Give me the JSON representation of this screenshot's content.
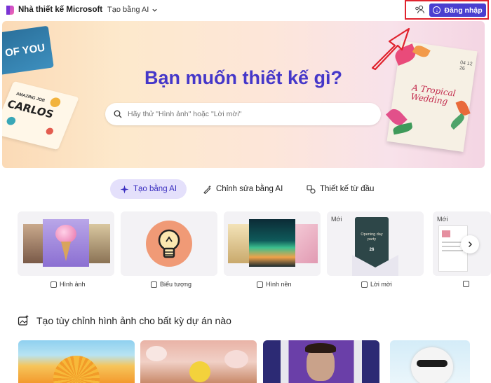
{
  "header": {
    "brand": "Nhà thiết kế Microsoft",
    "create_menu": "Tạo bằng AI",
    "signin_label": "Đăng nhập"
  },
  "hero": {
    "title": "Bạn muốn thiết kế gì?",
    "search_placeholder": "Hãy thử \"Hình ảnh\" hoặc \"Lời mời\"",
    "card_you": "OF YOU",
    "card_carlos_top": "AMAZING JOB",
    "card_carlos": "CARLOS",
    "card_wedding": "A Tropical Wedding",
    "card_wedding_date": "04 12 26"
  },
  "tabs": [
    {
      "label": "Tạo bằng AI",
      "active": true
    },
    {
      "label": "Chỉnh sửa bằng AI",
      "active": false
    },
    {
      "label": "Thiết kế từ đầu",
      "active": false
    }
  ],
  "tiles": [
    {
      "label": "Hình ảnh",
      "badge": ""
    },
    {
      "label": "Biểu tượng",
      "badge": ""
    },
    {
      "label": "Hình nền",
      "badge": ""
    },
    {
      "label": "Lời mời",
      "badge": "Mới",
      "card_title": "Opening day party",
      "card_date": "26"
    },
    {
      "label": "",
      "badge": "Mới"
    }
  ],
  "section": {
    "heading": "Tạo tùy chỉnh hình ảnh cho bất kỳ dự án nào"
  },
  "colors": {
    "accent": "#4a3fd0",
    "title": "#4537c9",
    "annotation_red": "#e0232e"
  }
}
